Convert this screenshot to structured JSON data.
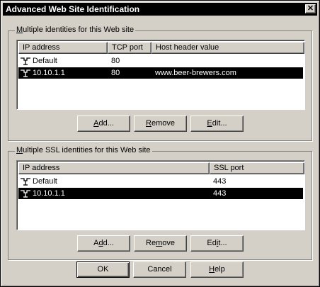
{
  "window": {
    "title": "Advanced Web Site Identification",
    "close_glyph": "✕"
  },
  "identities": {
    "group_label_access": "M",
    "group_label_rest": "ultiple identities for this Web site",
    "columns": [
      "IP address",
      "TCP port",
      "Host header value"
    ],
    "rows": [
      {
        "ip": "Default",
        "port": "80",
        "host": "",
        "selected": false
      },
      {
        "ip": "10.10.1.1",
        "port": "80",
        "host": "www.beer-brewers.com",
        "selected": true
      }
    ],
    "buttons": {
      "add": {
        "access": "A",
        "rest": "dd..."
      },
      "remove": {
        "access": "R",
        "rest": "emove"
      },
      "edit": {
        "access": "E",
        "rest": "dit..."
      }
    }
  },
  "ssl": {
    "group_label_access": "M",
    "group_label_rest": "ultiple SSL identities for this Web site",
    "columns": [
      "IP address",
      "SSL port"
    ],
    "rows": [
      {
        "ip": "Default",
        "port": "443",
        "selected": false
      },
      {
        "ip": "10.10.1.1",
        "port": "443",
        "selected": true
      }
    ],
    "buttons": {
      "add": {
        "pre": "A",
        "access": "d",
        "rest": "d..."
      },
      "remove": {
        "pre": "Re",
        "access": "m",
        "rest": "ove"
      },
      "edit": {
        "pre": "Ed",
        "access": "i",
        "rest": "t..."
      }
    }
  },
  "footer": {
    "ok": "OK",
    "cancel": "Cancel",
    "help_access": "H",
    "help_rest": "elp"
  },
  "icons": {
    "row_icon": "network-adapter-icon"
  }
}
